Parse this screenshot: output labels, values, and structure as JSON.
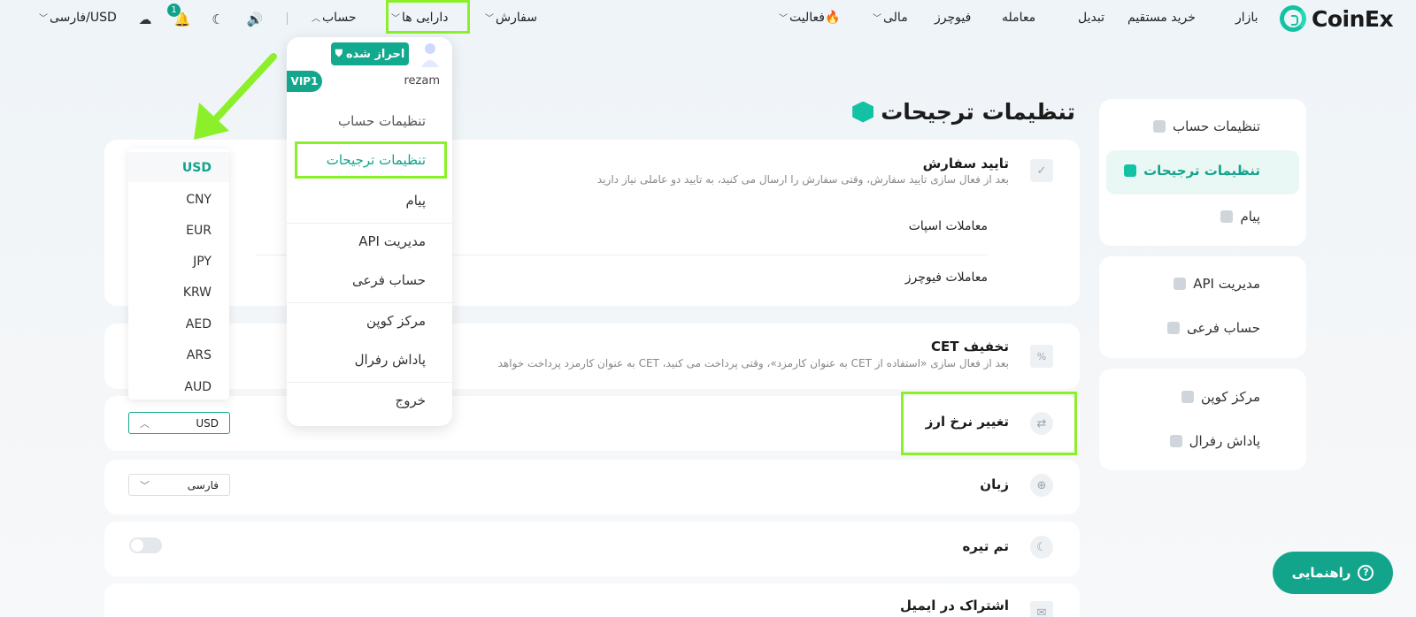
{
  "nav": {
    "brand": "CoinEx",
    "items": {
      "market": "بازار",
      "buy": "خرید مستقیم",
      "convert": "تبدیل",
      "trade": "معامله",
      "futures": "فیوچرز",
      "finance": "مالی",
      "activity": "فعالیت",
      "orders": "سفارش",
      "assets": "دارایی ها",
      "account": "حساب",
      "lang_currency": "فارسی/USD"
    },
    "notification_count": "1"
  },
  "page_title": "تنظیمات ترجیحات",
  "sidebar": {
    "group1": [
      "تنظیمات حساب",
      "تنظیمات ترجیحات",
      "پیام"
    ],
    "group2": [
      "مدیریت API",
      "حساب فرعی"
    ],
    "group3": [
      "مرکز کوپن",
      "پاداش رفرال"
    ]
  },
  "settings": {
    "order_confirm": {
      "title": "تایید سفارش",
      "desc": "بعد از فعال سازی تایید سفارش، وقتی سفارش را ارسال می کنید، به تایید دو عاملی نیاز دارید",
      "spot": "معاملات اسپات",
      "futures": "معاملات فیوچرز"
    },
    "cet_discount": {
      "title": "تخفیف CET",
      "desc": "بعد از فعال سازی «استفاده از CET به عنوان کارمزد»، وقتی پرداخت می کنید، CET به عنوان کارمزد پرداخت خواهد"
    },
    "currency": {
      "title": "تغییر نرخ ارز",
      "value": "USD"
    },
    "language": {
      "title": "زبان",
      "value": "فارسی"
    },
    "dark_theme": {
      "title": "تم تیره"
    },
    "email": {
      "title": "اشتراک در ایمیل"
    }
  },
  "account_menu": {
    "verified": "احراز شده",
    "vip": "VIP1",
    "username": "rezam",
    "items": [
      "تنظیمات حساب",
      "تنظیمات ترجیحات",
      "پیام",
      "مدیریت API",
      "حساب فرعی",
      "مرکز کوپن",
      "پاداش رفرال",
      "خروج"
    ]
  },
  "currency_options": [
    "USD",
    "CNY",
    "EUR",
    "JPY",
    "KRW",
    "AED",
    "ARS",
    "AUD"
  ],
  "help_button": "راهنمایی",
  "colors": {
    "accent": "#12c2a3",
    "highlight": "#8bf02a",
    "button": "#13a58c"
  }
}
